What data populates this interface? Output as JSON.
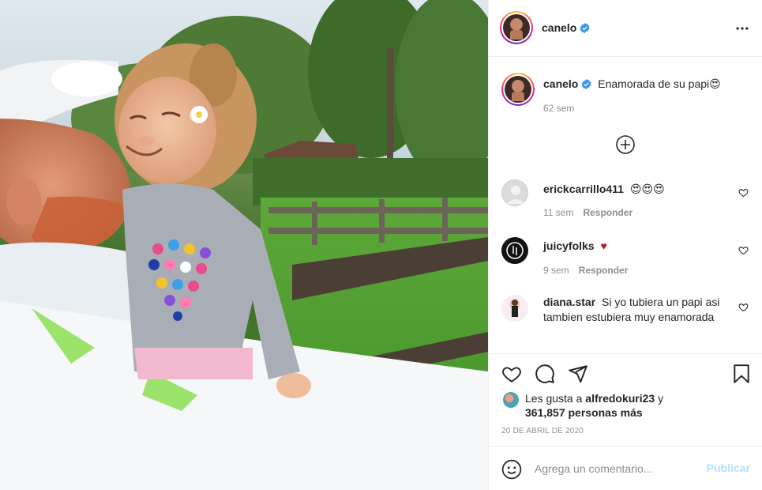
{
  "post": {
    "author": "canelo",
    "verified": true,
    "photo_alt": "Father and little girl smiling at each other"
  },
  "header": {
    "username": "canelo",
    "more_icon": "more-horizontal-icon"
  },
  "caption": {
    "username": "canelo",
    "text": "Enamorada de su papi😍",
    "time": "62 sem"
  },
  "comments": [
    {
      "username": "erickcarrillo411",
      "text": "😍😍😍",
      "time": "11 sem",
      "reply": "Responder"
    },
    {
      "username": "juicyfolks",
      "text": "♥",
      "time": "9 sem",
      "reply": "Responder"
    },
    {
      "username": "diana.star",
      "text": "Si yo tubiera un papi asi tambien estubiera muy enamorada"
    }
  ],
  "actions": {
    "like_icon": "heart-icon",
    "comment_icon": "comment-icon",
    "share_icon": "share-icon",
    "save_icon": "bookmark-icon"
  },
  "likes": {
    "prefix": "Les gusta a",
    "first_user": "alfredokuri23",
    "suffix": "y",
    "others": "361,857 personas más"
  },
  "date": "20 DE ABRIL DE 2020",
  "add_comment": {
    "placeholder": "Agrega un comentario...",
    "publish_label": "Publicar"
  },
  "colors": {
    "accent": "#0095f6",
    "publish_disabled": "#b2dffc",
    "heart_red": "#ed4956",
    "meta_gray": "#8e8e8e",
    "border": "#efefef"
  }
}
